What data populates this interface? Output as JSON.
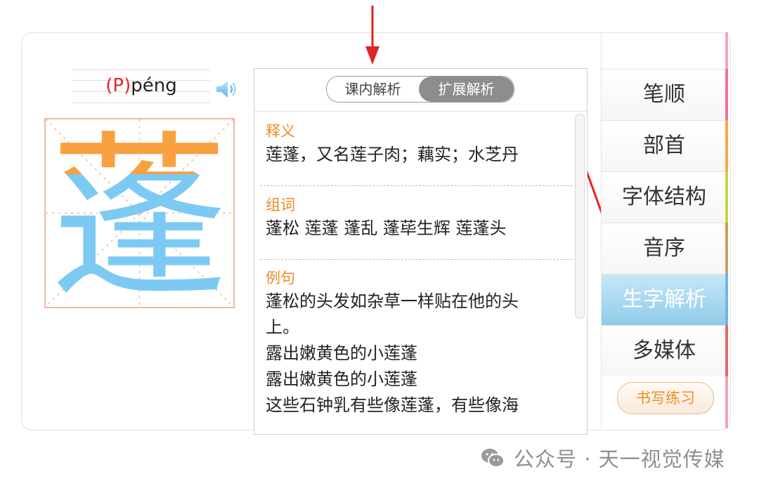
{
  "pinyin": {
    "marker": "(P)",
    "syllable": "péng"
  },
  "icons": {
    "speaker": "speaker-icon",
    "wechat": "wechat-icon",
    "arrow": "red-arrow-icon"
  },
  "character": {
    "glyph": "蓬",
    "top_color": "#f9a041",
    "bottom_color": "#7ccaf3"
  },
  "tabs": {
    "left_label": "课内解析",
    "right_label": "扩展解析",
    "active": "扩展解析"
  },
  "sections": {
    "meaning": {
      "heading": "释义",
      "lines": [
        "莲蓬，又名莲子肉；藕实；水芝丹"
      ]
    },
    "words": {
      "heading": "组词",
      "lines": [
        "蓬松 莲蓬 蓬乱 蓬荜生辉 莲蓬头"
      ]
    },
    "examples": {
      "heading": "例句",
      "lines": [
        "蓬松的头发如杂草一样贴在他的头",
        "上。",
        "露出嫩黄色的小莲蓬",
        "露出嫩黄色的小莲蓬",
        "这些石钟乳有些像莲蓬，有些像海"
      ]
    }
  },
  "nav": {
    "items": [
      {
        "label": "笔顺",
        "stripe": "#f06fa3"
      },
      {
        "label": "部首",
        "stripe": "#f6a84a"
      },
      {
        "label": "字体结构",
        "stripe": "#c9d44a"
      },
      {
        "label": "音序",
        "stripe": "#c8a25a"
      },
      {
        "label": "生字解析",
        "stripe": "#6fb6e6",
        "active": true
      },
      {
        "label": "多媒体",
        "stripe": "#e36a6a"
      }
    ],
    "practice_label": "书写练习"
  },
  "colors": {
    "accent_orange": "#f08a24",
    "active_blue": "#8fcbea",
    "arrow_red": "#e12323"
  },
  "watermark": {
    "text": "公众号 · 天一视觉传媒"
  }
}
